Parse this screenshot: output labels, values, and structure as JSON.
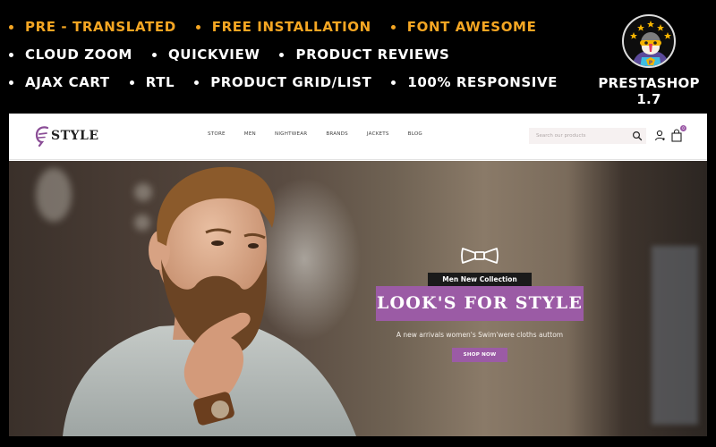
{
  "features": {
    "rows": [
      [
        {
          "label": "PRE - TRANSLATED",
          "tone": "gold"
        },
        {
          "label": "FREE INSTALLATION",
          "tone": "gold"
        },
        {
          "label": "FONT AWESOME",
          "tone": "gold"
        }
      ],
      [
        {
          "label": "CLOUD ZOOM",
          "tone": "white"
        },
        {
          "label": "QUICKVIEW",
          "tone": "white"
        },
        {
          "label": "PRODUCT REVIEWS",
          "tone": "white"
        }
      ],
      [
        {
          "label": "AJAX CART",
          "tone": "white"
        },
        {
          "label": "RTL",
          "tone": "white"
        },
        {
          "label": "PRODUCT GRID/LIST",
          "tone": "white"
        },
        {
          "label": "100% RESPONSIVE",
          "tone": "white"
        }
      ]
    ]
  },
  "badge": {
    "icon": "prestashop-puffin-logo",
    "label": "PRESTASHOP 1.7"
  },
  "store": {
    "logo_text": "STYLE",
    "logo_icon": "f-swirl-logo",
    "nav": [
      "STORE",
      "MEN",
      "NIGHTWEAR",
      "BRANDS",
      "JACKETS",
      "BLOG"
    ],
    "search": {
      "placeholder": "Search our products",
      "value": ""
    },
    "icons": {
      "search": "search-icon",
      "user": "user-icon",
      "cart": "shopping-bag-icon"
    },
    "cart_count": "0",
    "hero": {
      "icon": "bow-tie-icon",
      "collection_label": "Men New Collection",
      "title": "LOOK'S FOR STYLE",
      "subtitle": "A new arrivals women's Swim'were cloths auttom",
      "cta": "SHOP NOW"
    }
  },
  "colors": {
    "gold": "#f5a623",
    "accent_purple": "#9b5ba5",
    "background": "#000000",
    "label_dark": "#1a1a1a"
  }
}
